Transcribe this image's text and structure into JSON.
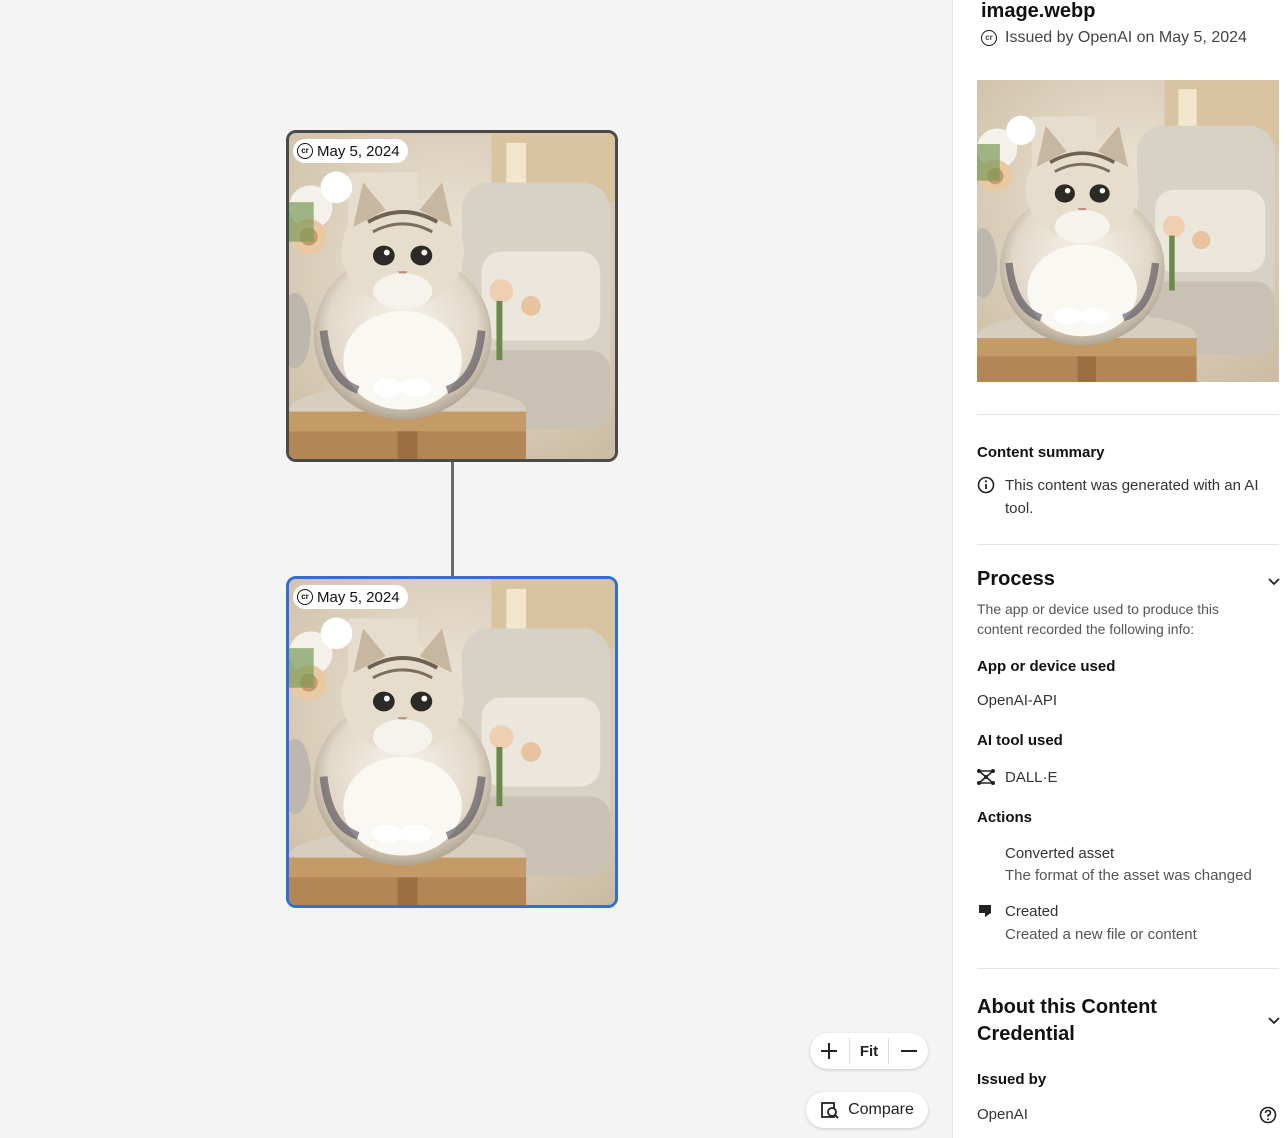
{
  "canvas": {
    "nodes": [
      {
        "date": "May 5, 2024",
        "selected": false
      },
      {
        "date": "May 5, 2024",
        "selected": true
      }
    ],
    "zoom": {
      "plus": "+",
      "fit": "Fit",
      "minus": "—"
    },
    "compare_label": "Compare"
  },
  "panel": {
    "title": "image.webp",
    "issued_text": "Issued by OpenAI on May 5, 2024",
    "content_summary": {
      "heading": "Content summary",
      "text": "This content was generated with an AI tool."
    },
    "process": {
      "heading": "Process",
      "description": "The app or device used to produce this content recorded the following info:",
      "app_heading": "App or device used",
      "app_value": "OpenAI-API",
      "ai_tool_heading": "AI tool used",
      "ai_tool_value": "DALL·E",
      "actions_heading": "Actions",
      "actions": [
        {
          "title": "Converted asset",
          "description": "The format of the asset was changed",
          "icon": "none"
        },
        {
          "title": "Created",
          "description": "Created a new file or content",
          "icon": "created-icon"
        }
      ]
    },
    "about": {
      "heading": "About this Content Credential",
      "issued_by_heading": "Issued by",
      "issued_by_value": "OpenAI"
    }
  },
  "colors": {
    "selected_border": "#2f6fd6",
    "node_border": "#4a4a4a",
    "canvas_bg": "#f4f4f4"
  }
}
